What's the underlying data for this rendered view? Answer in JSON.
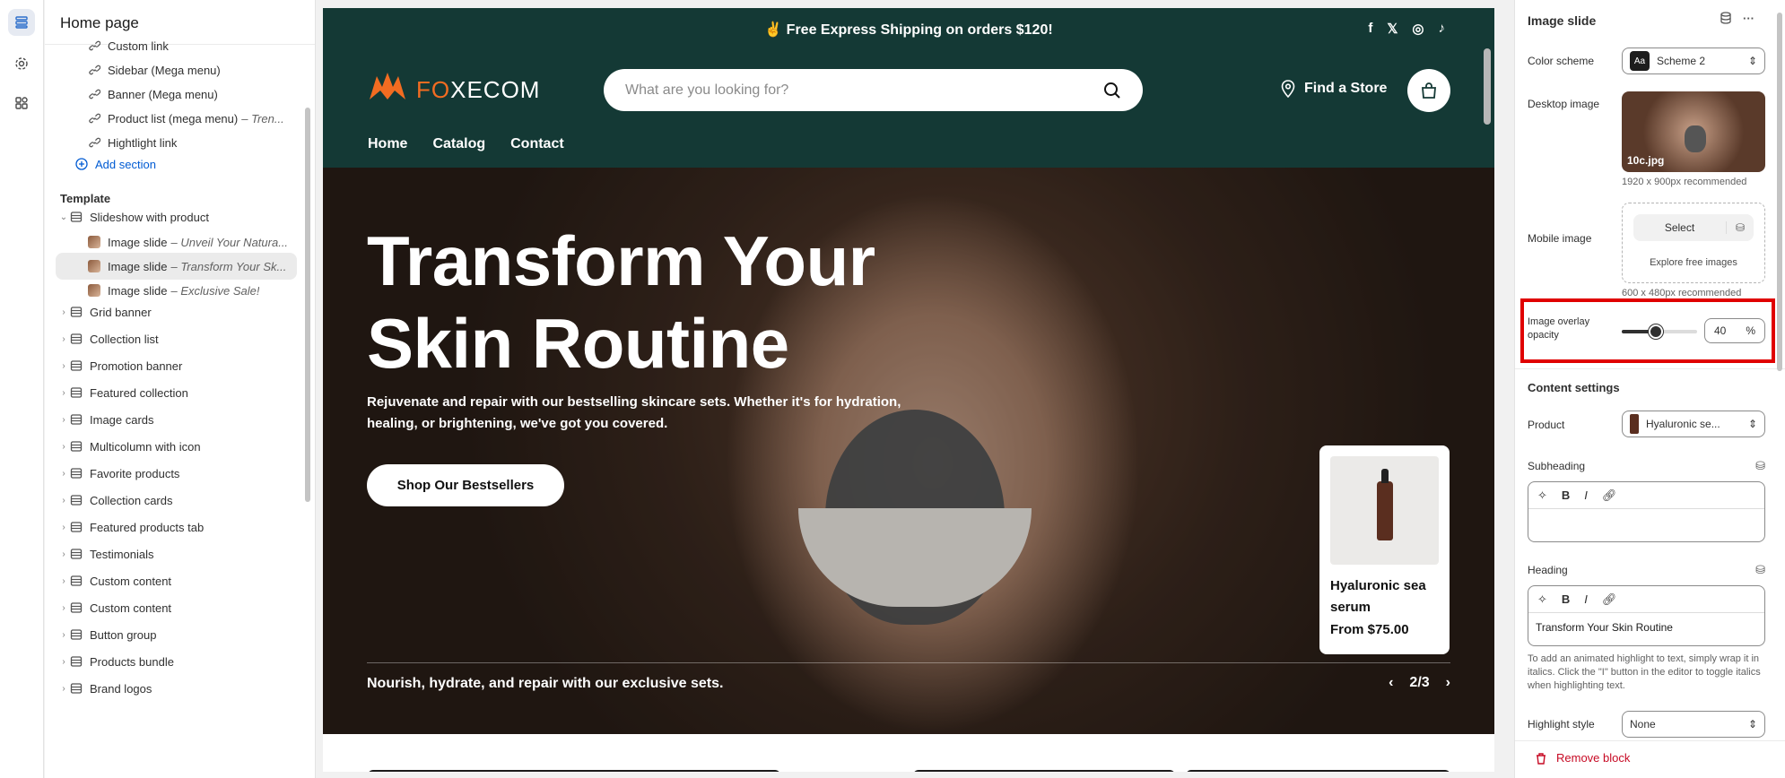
{
  "left_panel": {
    "title": "Home page",
    "items": [
      {
        "label": "Custom link",
        "sub": ""
      },
      {
        "label": "Sidebar (Mega menu)",
        "sub": ""
      },
      {
        "label": "Banner (Mega menu)",
        "sub": ""
      },
      {
        "label": "Product list (mega menu)",
        "sub": "– Tren..."
      },
      {
        "label": "Hightlight link",
        "sub": ""
      }
    ],
    "add_section": "Add section",
    "template_label": "Template",
    "slideshow": "Slideshow with product",
    "slides": [
      {
        "label": "Image slide",
        "sub": "– Unveil Your Natura..."
      },
      {
        "label": "Image slide",
        "sub": "– Transform Your Sk..."
      },
      {
        "label": "Image slide",
        "sub": "– Exclusive Sale!"
      }
    ],
    "sections": [
      "Grid banner",
      "Collection list",
      "Promotion banner",
      "Featured collection",
      "Image cards",
      "Multicolumn with icon",
      "Favorite products",
      "Collection cards",
      "Featured products tab",
      "Testimonials",
      "Custom content",
      "Custom content",
      "Button group",
      "Products bundle",
      "Brand logos"
    ]
  },
  "preview": {
    "announcement": "✌️ Free Express Shipping on orders $120!",
    "logo_text_a": "F",
    "logo_text_o": "O",
    "logo_text_rest": "XECOM",
    "search_placeholder": "What are you looking for?",
    "find_store": "Find a Store",
    "nav": [
      "Home",
      "Catalog",
      "Contact"
    ],
    "hero_title": "Transform Your Skin Routine",
    "hero_desc": "Rejuvenate and repair with our bestselling skincare sets. Whether it's for hydration, healing, or brightening, we've got you covered.",
    "hero_button": "Shop Our Bestsellers",
    "product_name": "Hyaluronic sea serum",
    "product_price": "From $75.00",
    "tagline": "Nourish, hydrate, and repair with our exclusive sets.",
    "pager": "2/3"
  },
  "right_panel": {
    "title": "Image slide",
    "color_scheme_label": "Color scheme",
    "color_scheme_value": "Scheme 2",
    "desktop_image_label": "Desktop image",
    "desktop_image_file": "10c.jpg",
    "desktop_hint": "1920 x 900px recommended",
    "mobile_image_label": "Mobile image",
    "mobile_select": "Select",
    "mobile_explore": "Explore free images",
    "mobile_hint": "600 x 480px recommended",
    "overlay_label": "Image overlay opacity",
    "overlay_value": "40",
    "overlay_unit": "%",
    "content_settings": "Content settings",
    "product_label": "Product",
    "product_value": "Hyaluronic se...",
    "subheading_label": "Subheading",
    "subheading_value": "",
    "heading_label": "Heading",
    "heading_value": "Transform Your Skin Routine",
    "help_text": "To add an animated highlight to text, simply wrap it in italics. Click the \"I\" button in the editor to toggle italics when highlighting text.",
    "highlight_label": "Highlight style",
    "highlight_value": "None",
    "remove_block": "Remove block"
  }
}
